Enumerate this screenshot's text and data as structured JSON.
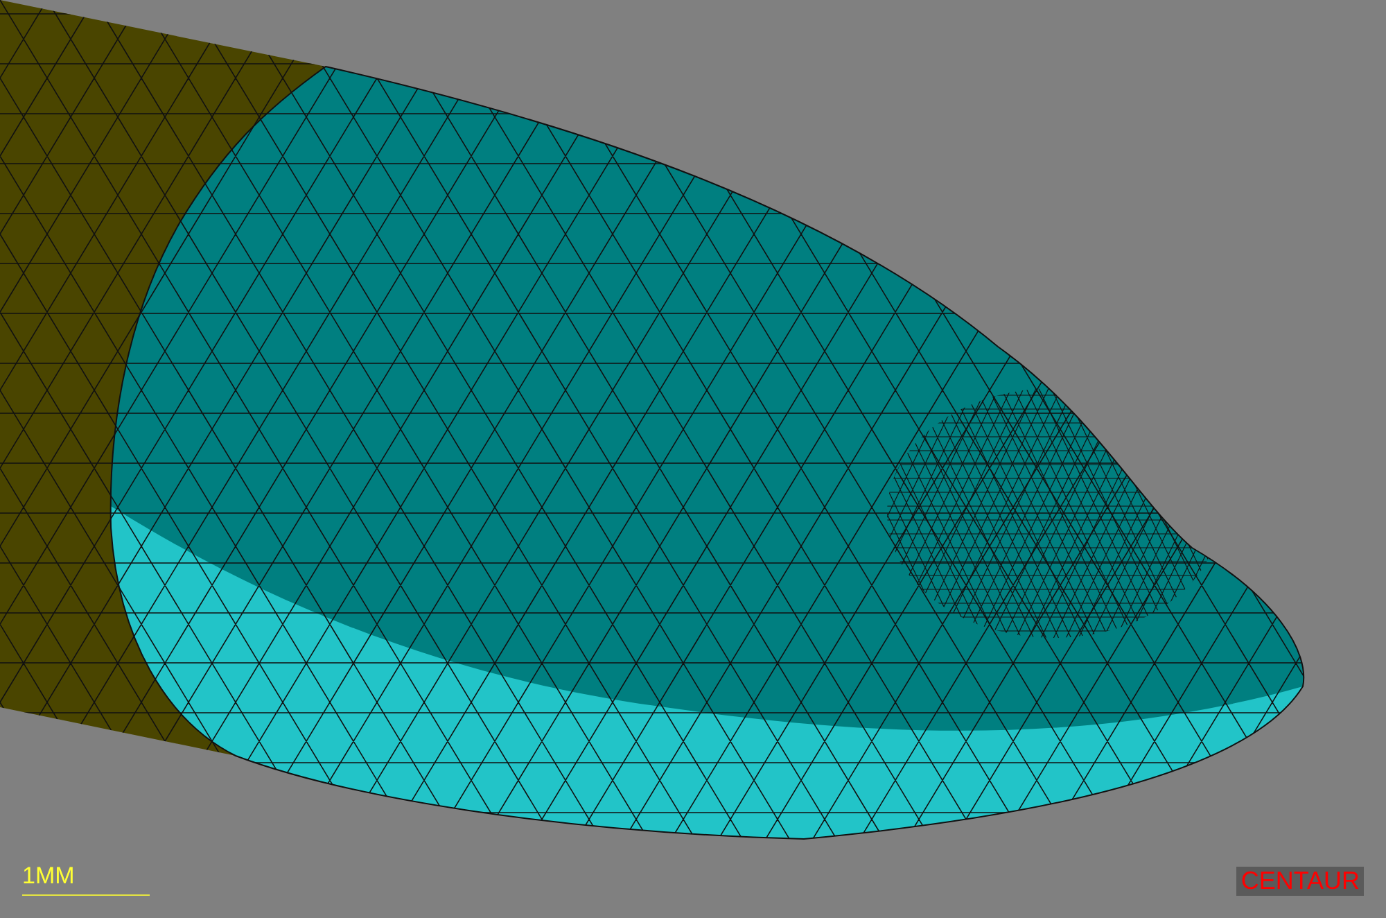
{
  "viewport": {
    "scale_bar": {
      "label": "1MM"
    },
    "logo": "CENTAUR"
  }
}
